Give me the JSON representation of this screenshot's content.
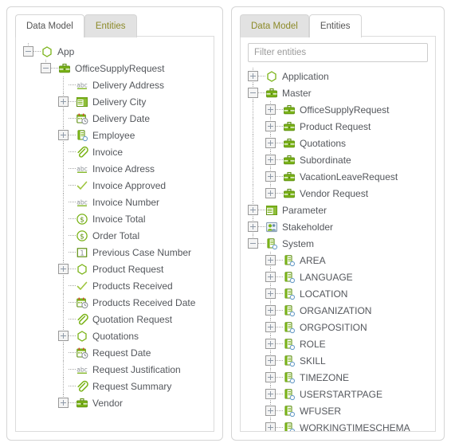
{
  "panels": {
    "left": {
      "tabs": [
        {
          "label": "Data Model",
          "active": true
        },
        {
          "label": "Entities",
          "active": false
        }
      ],
      "tree": [
        {
          "label": "App",
          "icon": "hexagon-icon",
          "depth": 0,
          "toggle": "minus"
        },
        {
          "label": "OfficeSupplyRequest",
          "icon": "briefcase-icon",
          "depth": 1,
          "toggle": "minus"
        },
        {
          "label": "Delivery Address",
          "icon": "abc-text-icon",
          "depth": 2,
          "toggle": "none"
        },
        {
          "label": "Delivery City",
          "icon": "table-icon",
          "depth": 2,
          "toggle": "plus"
        },
        {
          "label": "Delivery Date",
          "icon": "calendar-clock-icon",
          "depth": 2,
          "toggle": "none"
        },
        {
          "label": "Employee",
          "icon": "record-link-icon",
          "depth": 2,
          "toggle": "plus"
        },
        {
          "label": "Invoice",
          "icon": "paperclip-icon",
          "depth": 2,
          "toggle": "none"
        },
        {
          "label": "Invoice Adress",
          "icon": "abc-text-icon",
          "depth": 2,
          "toggle": "none"
        },
        {
          "label": "Invoice Approved",
          "icon": "checkmark-icon",
          "depth": 2,
          "toggle": "none"
        },
        {
          "label": "Invoice Number",
          "icon": "abc-text-icon",
          "depth": 2,
          "toggle": "none"
        },
        {
          "label": "Invoice Total",
          "icon": "currency-icon",
          "depth": 2,
          "toggle": "none"
        },
        {
          "label": "Order Total",
          "icon": "currency-icon",
          "depth": 2,
          "toggle": "none"
        },
        {
          "label": "Previous Case Number",
          "icon": "number-one-icon",
          "depth": 2,
          "toggle": "none"
        },
        {
          "label": "Product Request",
          "icon": "relation-icon",
          "depth": 2,
          "toggle": "plus"
        },
        {
          "label": "Products Received",
          "icon": "checkmark-icon",
          "depth": 2,
          "toggle": "none"
        },
        {
          "label": "Products Received Date",
          "icon": "calendar-clock-icon",
          "depth": 2,
          "toggle": "none"
        },
        {
          "label": "Quotation Request",
          "icon": "paperclip-icon",
          "depth": 2,
          "toggle": "none"
        },
        {
          "label": "Quotations",
          "icon": "relation-icon",
          "depth": 2,
          "toggle": "plus"
        },
        {
          "label": "Request Date",
          "icon": "calendar-clock-icon",
          "depth": 2,
          "toggle": "none"
        },
        {
          "label": "Request Justification",
          "icon": "abc-text-icon",
          "depth": 2,
          "toggle": "none"
        },
        {
          "label": "Request Summary",
          "icon": "paperclip-icon",
          "depth": 2,
          "toggle": "none"
        },
        {
          "label": "Vendor",
          "icon": "briefcase-icon",
          "depth": 2,
          "toggle": "plus"
        }
      ]
    },
    "right": {
      "tabs": [
        {
          "label": "Data Model",
          "active": false
        },
        {
          "label": "Entities",
          "active": true
        }
      ],
      "filter": {
        "value": "",
        "placeholder": "Filter entities"
      },
      "tree": [
        {
          "label": "Application",
          "icon": "hexagon-icon",
          "depth": 0,
          "toggle": "plus"
        },
        {
          "label": "Master",
          "icon": "briefcase-icon",
          "depth": 0,
          "toggle": "minus"
        },
        {
          "label": "OfficeSupplyRequest",
          "icon": "briefcase-icon",
          "depth": 1,
          "toggle": "plus"
        },
        {
          "label": "Product Request",
          "icon": "briefcase-icon",
          "depth": 1,
          "toggle": "plus"
        },
        {
          "label": "Quotations",
          "icon": "briefcase-icon",
          "depth": 1,
          "toggle": "plus"
        },
        {
          "label": "Subordinate",
          "icon": "briefcase-icon",
          "depth": 1,
          "toggle": "plus"
        },
        {
          "label": "VacationLeaveRequest",
          "icon": "briefcase-icon",
          "depth": 1,
          "toggle": "plus"
        },
        {
          "label": "Vendor Request",
          "icon": "briefcase-icon",
          "depth": 1,
          "toggle": "plus"
        },
        {
          "label": "Parameter",
          "icon": "table-icon",
          "depth": 0,
          "toggle": "plus"
        },
        {
          "label": "Stakeholder",
          "icon": "people-icon",
          "depth": 0,
          "toggle": "plus"
        },
        {
          "label": "System",
          "icon": "record-link-icon",
          "depth": 0,
          "toggle": "minus"
        },
        {
          "label": "AREA",
          "icon": "record-link-icon",
          "depth": 1,
          "toggle": "plus"
        },
        {
          "label": "LANGUAGE",
          "icon": "record-link-icon",
          "depth": 1,
          "toggle": "plus"
        },
        {
          "label": "LOCATION",
          "icon": "record-link-icon",
          "depth": 1,
          "toggle": "plus"
        },
        {
          "label": "ORGANIZATION",
          "icon": "record-link-icon",
          "depth": 1,
          "toggle": "plus"
        },
        {
          "label": "ORGPOSITION",
          "icon": "record-link-icon",
          "depth": 1,
          "toggle": "plus"
        },
        {
          "label": "ROLE",
          "icon": "record-link-icon",
          "depth": 1,
          "toggle": "plus"
        },
        {
          "label": "SKILL",
          "icon": "record-link-icon",
          "depth": 1,
          "toggle": "plus"
        },
        {
          "label": "TIMEZONE",
          "icon": "record-link-icon",
          "depth": 1,
          "toggle": "plus"
        },
        {
          "label": "USERSTARTPAGE",
          "icon": "record-link-icon",
          "depth": 1,
          "toggle": "plus"
        },
        {
          "label": "WFUSER",
          "icon": "record-link-icon",
          "depth": 1,
          "toggle": "plus"
        },
        {
          "label": "WORKINGTIMESCHEMA",
          "icon": "record-link-icon",
          "depth": 1,
          "toggle": "plus"
        }
      ]
    }
  },
  "colors": {
    "accent_green": "#7ab317",
    "accent_olive": "#8c8a28",
    "text": "#54575c",
    "tab_inactive_bg": "#e2e2e2",
    "panel_border": "#d5d5d5"
  }
}
